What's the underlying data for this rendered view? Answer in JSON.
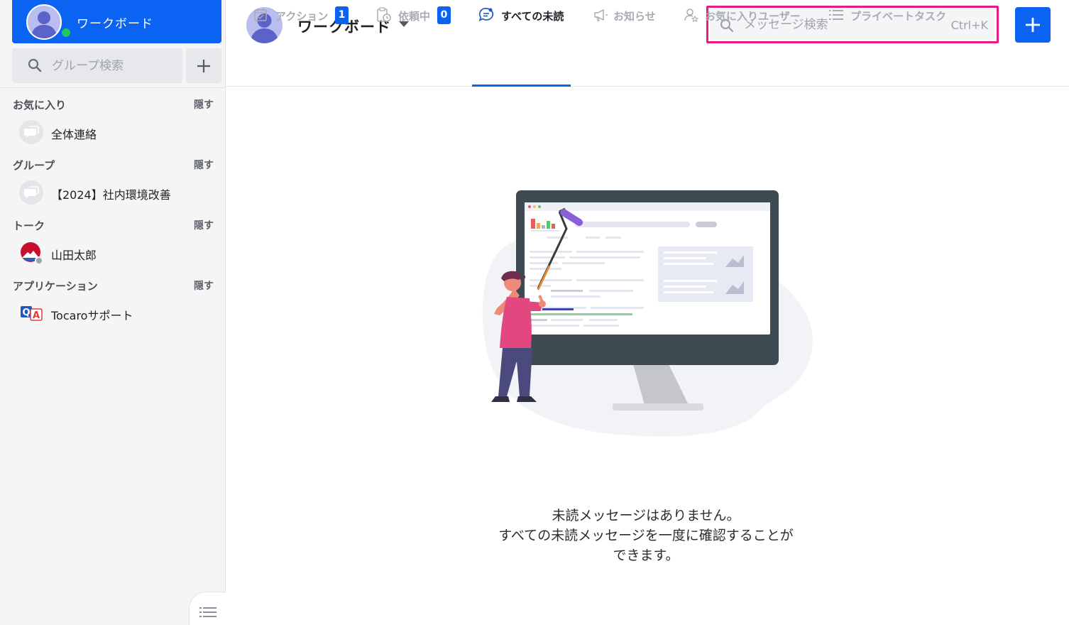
{
  "sidebar": {
    "workspace_label": "ワークボード",
    "group_search_placeholder": "グループ検索",
    "sections": [
      {
        "title": "お気に入り",
        "hide_label": "隠す",
        "items": [
          {
            "label": "全体連絡",
            "icon": "chat-bubble-icon"
          }
        ]
      },
      {
        "title": "グループ",
        "hide_label": "隠す",
        "items": [
          {
            "label": "【2024】社内環境改善",
            "icon": "chat-bubble-icon"
          }
        ]
      },
      {
        "title": "トーク",
        "hide_label": "隠す",
        "items": [
          {
            "label": "山田太郎",
            "icon": "user-avatar-icon"
          }
        ]
      },
      {
        "title": "アプリケーション",
        "hide_label": "隠す",
        "items": [
          {
            "label": "Tocaroサポート",
            "icon": "qa-app-icon"
          }
        ]
      }
    ]
  },
  "header": {
    "title": "ワークボード",
    "search_placeholder": "メッセージ検索",
    "search_shortcut": "Ctrl+K"
  },
  "tabs": [
    {
      "label": "アクション",
      "badge": "1",
      "icon": "calendar-check-icon",
      "active": false
    },
    {
      "label": "依頼中",
      "badge": "0",
      "icon": "clipboard-clock-icon",
      "active": false
    },
    {
      "label": "すべての未読",
      "badge": null,
      "icon": "chat-unread-icon",
      "active": true
    },
    {
      "label": "お知らせ",
      "badge": null,
      "icon": "megaphone-icon",
      "active": false
    },
    {
      "label": "お気に入りユーザー",
      "badge": null,
      "icon": "user-star-icon",
      "active": false
    },
    {
      "label": "プライベートタスク",
      "badge": null,
      "icon": "list-icon",
      "active": false
    }
  ],
  "empty_state": {
    "lines": [
      "未読メッセージはありません。",
      "すべての未読メッセージを一度に確認することが",
      "できます。"
    ]
  },
  "colors": {
    "accent": "#0b63f3",
    "search_highlight": "#ea1a84",
    "online": "#22c55e",
    "sidebar_bg": "#f5f5f6"
  }
}
